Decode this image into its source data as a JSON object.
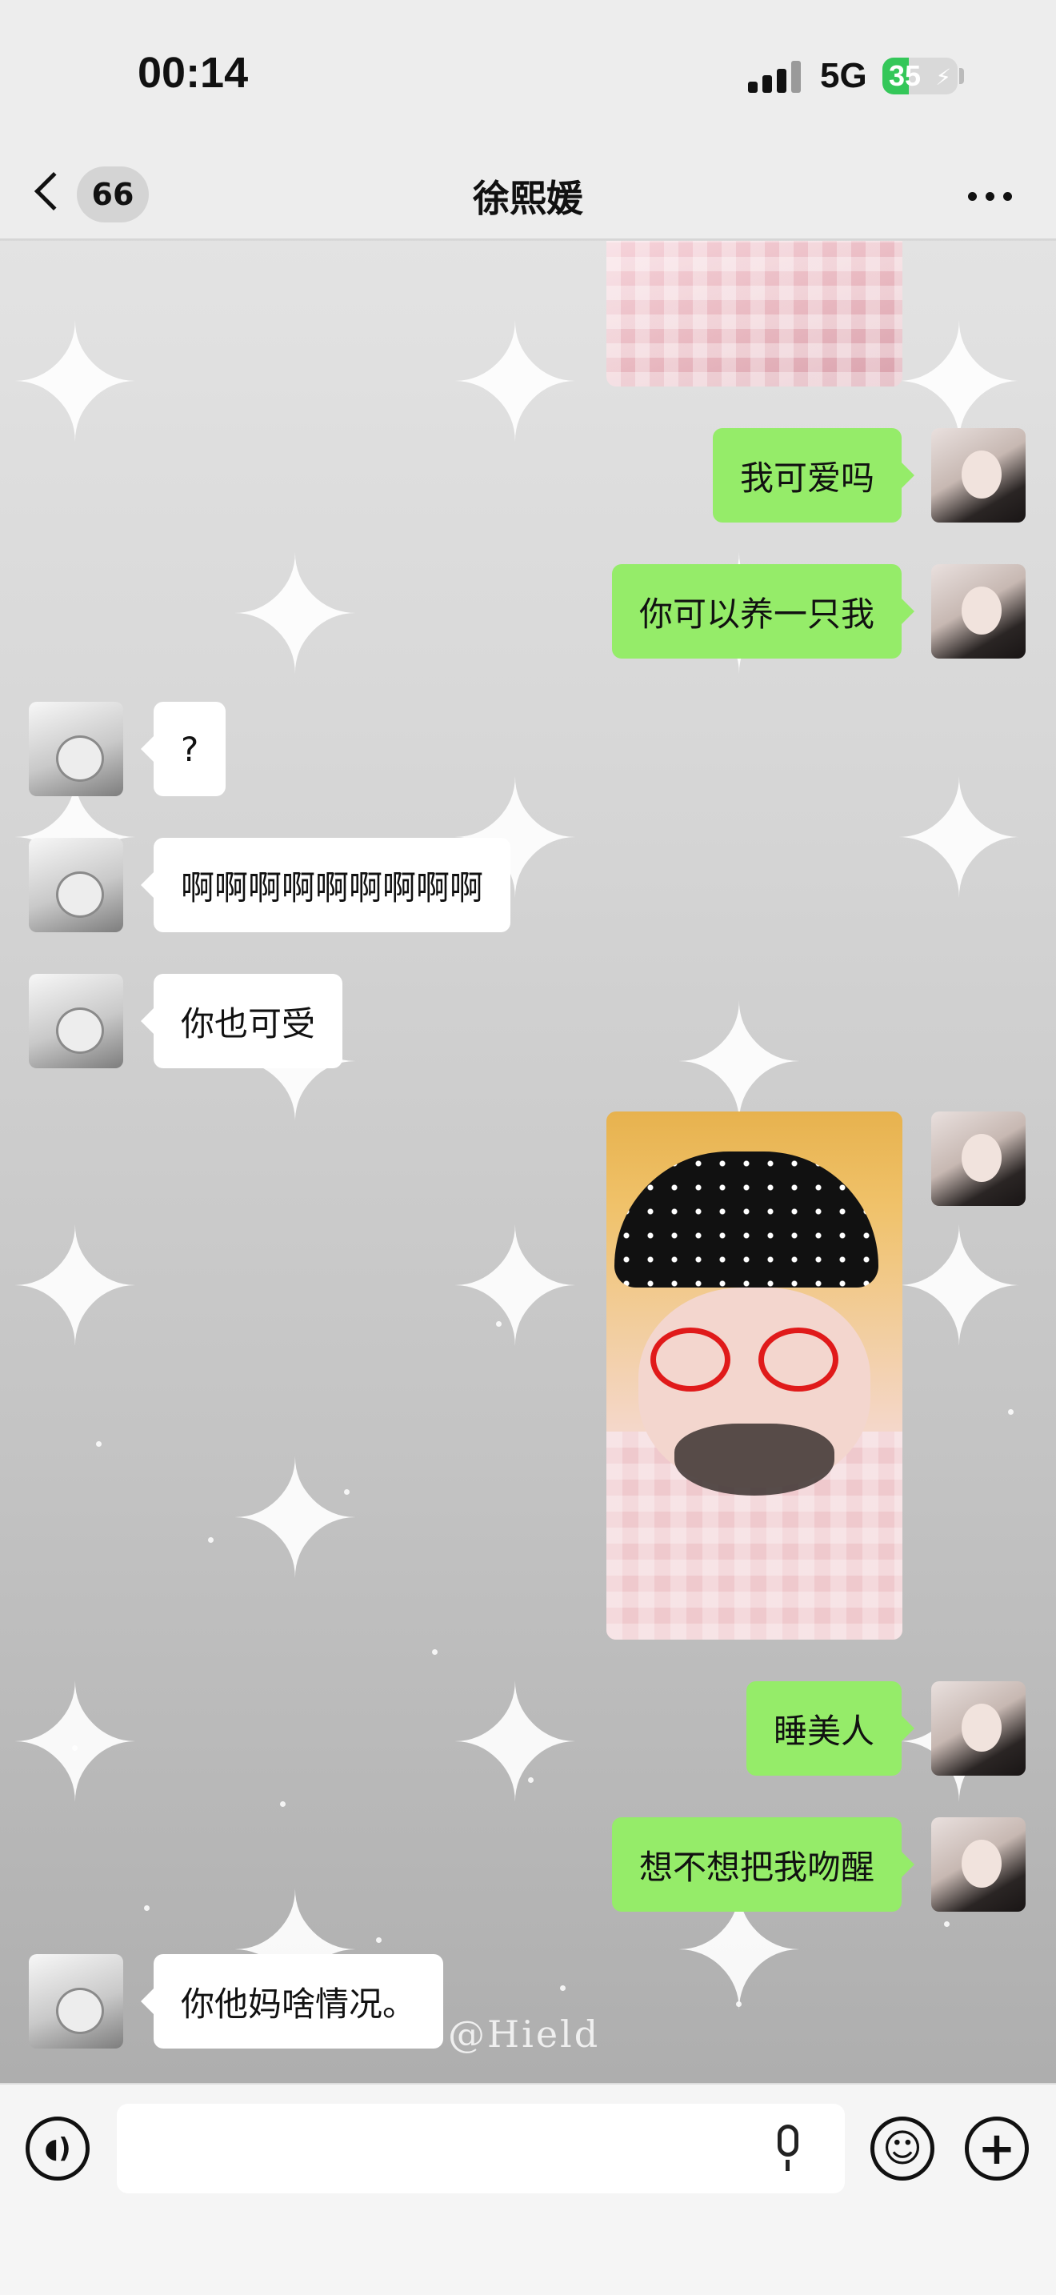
{
  "status_bar": {
    "time": "00:14",
    "network": "5G",
    "battery_level": "35",
    "battery_fraction": 0.35,
    "battery_color": "#34c759"
  },
  "nav": {
    "back_icon": "chevron-left-icon",
    "unread_count": "66",
    "title": "徐熙媛",
    "more_icon": "ellipsis-icon"
  },
  "colors": {
    "outgoing_bubble": "#95ec69",
    "incoming_bubble": "#ffffff"
  },
  "messages": [
    {
      "sender": "me",
      "type": "image",
      "description": "pink plaid blanket photo"
    },
    {
      "sender": "me",
      "type": "text",
      "text": "我可爱吗"
    },
    {
      "sender": "me",
      "type": "text",
      "text": "你可以养一只我"
    },
    {
      "sender": "them",
      "type": "text",
      "text": "?"
    },
    {
      "sender": "them",
      "type": "text",
      "text": "啊啊啊啊啊啊啊啊啊"
    },
    {
      "sender": "them",
      "type": "text",
      "text": "你也可受"
    },
    {
      "sender": "me",
      "type": "image",
      "description": "selfie with hat and red glasses filter"
    },
    {
      "sender": "me",
      "type": "text",
      "text": "睡美人"
    },
    {
      "sender": "me",
      "type": "text",
      "text": "想不想把我吻醒"
    },
    {
      "sender": "them",
      "type": "text",
      "text": "你他妈啥情况。"
    }
  ],
  "watermark": "@Hield",
  "input_bar": {
    "voice_icon": "voice-wave-icon",
    "text_value": "",
    "mic_icon": "microphone-icon",
    "emoji_icon": "smiley-icon",
    "plus_icon": "plus-icon"
  }
}
